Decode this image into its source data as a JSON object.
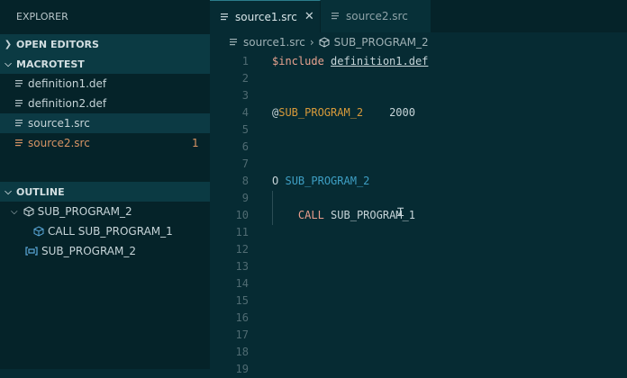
{
  "explorer": {
    "title": "EXPLORER",
    "open_editors": "OPEN EDITORS",
    "folder": "MACROTEST",
    "files": [
      {
        "name": "definition1.def",
        "badge": ""
      },
      {
        "name": "definition2.def",
        "badge": ""
      },
      {
        "name": "source1.src",
        "badge": ""
      },
      {
        "name": "source2.src",
        "badge": "1"
      }
    ],
    "outline": {
      "title": "OUTLINE",
      "items": [
        {
          "label": "SUB_PROGRAM_2"
        },
        {
          "label": "CALL SUB_PROGRAM_1"
        },
        {
          "label": "SUB_PROGRAM_2"
        }
      ]
    }
  },
  "tabs": [
    {
      "label": "source1.src",
      "close": "✕"
    },
    {
      "label": "source2.src"
    }
  ],
  "breadcrumb": {
    "file": "source1.src",
    "symbol": "SUB_PROGRAM_2"
  },
  "code": {
    "line_numbers": [
      "1",
      "2",
      "3",
      "4",
      "5",
      "6",
      "7",
      "8",
      "9",
      "10",
      "11",
      "12",
      "13",
      "14",
      "15",
      "16",
      "17",
      "18",
      "19"
    ],
    "l1_kw": "$include",
    "l1_arg": "definition1.def",
    "l4_at": "@",
    "l4_name": "SUB_PROGRAM_2",
    "l4_value": "2000",
    "l8_o": "O",
    "l8_name": "SUB_PROGRAM_2",
    "l10_call": "CALL",
    "l10_target": "SUB_PROGRAM_1"
  }
}
